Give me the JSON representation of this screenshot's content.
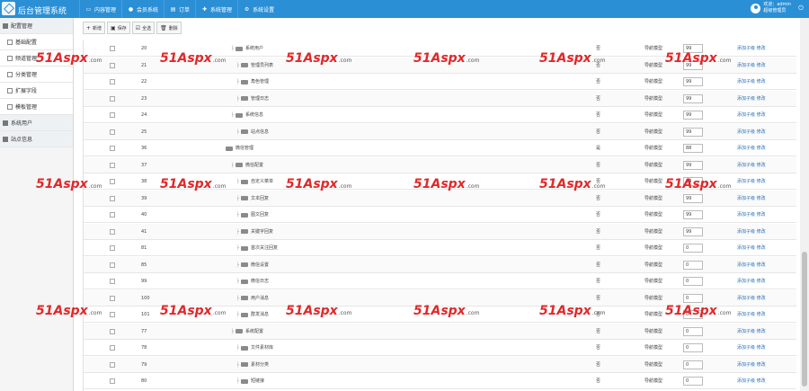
{
  "header": {
    "app_title": "后台管理系统",
    "nav": [
      {
        "label": "内容管理",
        "icon": "monitor-icon"
      },
      {
        "label": "会员系统",
        "icon": "user-icon"
      },
      {
        "label": "订单",
        "icon": "order-icon"
      },
      {
        "label": "系统管理",
        "icon": "puzzle-icon"
      },
      {
        "label": "系统设置",
        "icon": "gear-icon"
      }
    ],
    "user_line1": "欢迎：admin",
    "user_line2": "超级管理员"
  },
  "sidebar": {
    "items": [
      {
        "label": "配置管理",
        "level": "top"
      },
      {
        "label": "基础配置",
        "level": "sub"
      },
      {
        "label": "频道管理",
        "level": "sub"
      },
      {
        "label": "分类管理",
        "level": "sub"
      },
      {
        "label": "扩展字段",
        "level": "sub"
      },
      {
        "label": "模板管理",
        "level": "sub"
      },
      {
        "label": "系统用户",
        "level": "top"
      },
      {
        "label": "站点信息",
        "level": "top"
      }
    ]
  },
  "toolbar": {
    "add_label": "新增",
    "save_label": "保存",
    "select_all_label": "全选",
    "delete_label": "删除"
  },
  "table": {
    "op_add_child": "添加子级",
    "op_edit": "修改",
    "rows": [
      {
        "id": "20",
        "name": "系统用户",
        "indent": 1,
        "flag": "否",
        "type": "导航模型",
        "sort": "99"
      },
      {
        "id": "21",
        "name": "管理员列表",
        "indent": 2,
        "flag": "否",
        "type": "导航模型",
        "sort": "99"
      },
      {
        "id": "22",
        "name": "角色管理",
        "indent": 2,
        "flag": "否",
        "type": "导航模型",
        "sort": "99"
      },
      {
        "id": "23",
        "name": "管理日志",
        "indent": 2,
        "flag": "否",
        "type": "导航模型",
        "sort": "99"
      },
      {
        "id": "24",
        "name": "系统信息",
        "indent": 1,
        "flag": "否",
        "type": "导航模型",
        "sort": "99"
      },
      {
        "id": "25",
        "name": "站点信息",
        "indent": 2,
        "flag": "否",
        "type": "导航模型",
        "sort": "99"
      },
      {
        "id": "36",
        "name": "微信管理",
        "indent": 0,
        "flag": "是",
        "type": "导航模型",
        "sort": "88"
      },
      {
        "id": "37",
        "name": "微信配置",
        "indent": 1,
        "flag": "否",
        "type": "导航模型",
        "sort": "99"
      },
      {
        "id": "38",
        "name": "自定义菜单",
        "indent": 2,
        "flag": "否",
        "type": "导航模型",
        "sort": "99"
      },
      {
        "id": "39",
        "name": "文本回复",
        "indent": 2,
        "flag": "否",
        "type": "导航模型",
        "sort": "99"
      },
      {
        "id": "40",
        "name": "图文回复",
        "indent": 2,
        "flag": "否",
        "type": "导航模型",
        "sort": "99"
      },
      {
        "id": "41",
        "name": "关键字回复",
        "indent": 2,
        "flag": "否",
        "type": "导航模型",
        "sort": "99"
      },
      {
        "id": "81",
        "name": "首次关注回复",
        "indent": 2,
        "flag": "否",
        "type": "导航模型",
        "sort": "0"
      },
      {
        "id": "85",
        "name": "微信设置",
        "indent": 2,
        "flag": "否",
        "type": "导航模型",
        "sort": "0"
      },
      {
        "id": "99",
        "name": "微信日志",
        "indent": 2,
        "flag": "否",
        "type": "导航模型",
        "sort": "0"
      },
      {
        "id": "100",
        "name": "用户消息",
        "indent": 2,
        "flag": "否",
        "type": "导航模型",
        "sort": "0"
      },
      {
        "id": "101",
        "name": "群发消息",
        "indent": 2,
        "flag": "否",
        "type": "导航模型",
        "sort": "0"
      },
      {
        "id": "77",
        "name": "系统配置",
        "indent": 1,
        "flag": "否",
        "type": "导航模型",
        "sort": "0"
      },
      {
        "id": "78",
        "name": "文件素材库",
        "indent": 2,
        "flag": "否",
        "type": "导航模型",
        "sort": "0"
      },
      {
        "id": "79",
        "name": "素材分类",
        "indent": 2,
        "flag": "否",
        "type": "导航模型",
        "sort": "0"
      },
      {
        "id": "80",
        "name": "短链接",
        "indent": 2,
        "flag": "否",
        "type": "导航模型",
        "sort": "0"
      }
    ]
  },
  "watermark": {
    "brand": "51Aspx",
    "suffix": ".com"
  }
}
